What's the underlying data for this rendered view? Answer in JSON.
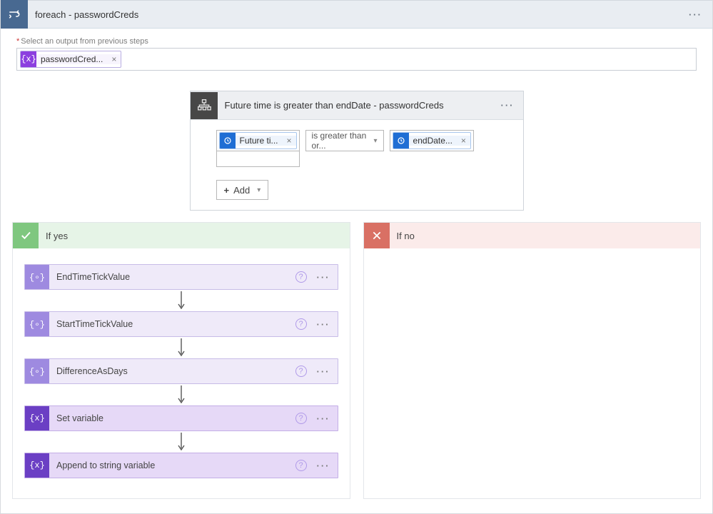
{
  "header": {
    "title": "foreach - passwordCreds"
  },
  "input": {
    "label": "Select an output from previous steps",
    "token": {
      "label": "passwordCred..."
    }
  },
  "condition": {
    "title": "Future time is greater than endDate - passwordCreds",
    "left_token": "Future ti...",
    "operator": "is greater than or...",
    "right_token": "endDate...",
    "add_label": "Add"
  },
  "branches": {
    "yes_label": "If yes",
    "no_label": "If no"
  },
  "steps": [
    {
      "label": "EndTimeTickValue",
      "variant": "light",
      "glyph": "curly-o"
    },
    {
      "label": "StartTimeTickValue",
      "variant": "light",
      "glyph": "curly-o"
    },
    {
      "label": "DifferenceAsDays",
      "variant": "light",
      "glyph": "curly-o"
    },
    {
      "label": "Set variable",
      "variant": "dark",
      "glyph": "curly-x"
    },
    {
      "label": "Append to string variable",
      "variant": "dark",
      "glyph": "curly-x"
    }
  ]
}
